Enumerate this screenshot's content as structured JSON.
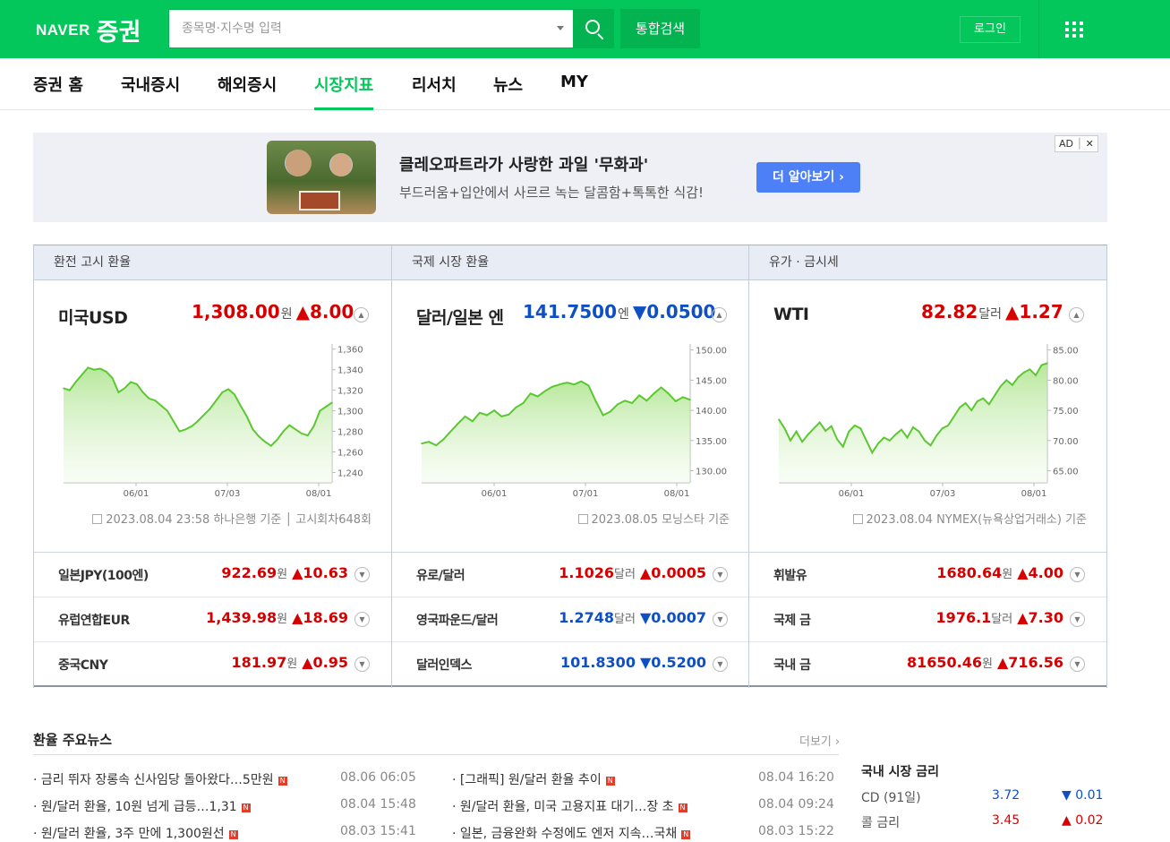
{
  "header": {
    "logo_brand": "NAVER",
    "logo_section": "증권",
    "search_placeholder": "종목명·지수명 입력",
    "search_button_label": "통합검색",
    "login_label": "로그인"
  },
  "nav": {
    "items": [
      "증권 홈",
      "국내증시",
      "해외증시",
      "시장지표",
      "리서치",
      "뉴스",
      "MY"
    ],
    "active": "시장지표"
  },
  "ad": {
    "title": "클레오파트라가 사랑한 과일 '무화과'",
    "desc": "부드러움+입안에서 사르르 녹는 달콤함+톡톡한 식감!",
    "button": "더 알아보기 ›",
    "tag": "AD",
    "close": "✕"
  },
  "panels": [
    {
      "header": "환전 고시 환율",
      "name": "미국USD",
      "price": "1,308.00",
      "unit": "원",
      "change": "▲8.00",
      "dir": "up",
      "source": "2023.08.04 23:58 하나은행 기준 │ 고시회차648회",
      "rows": [
        {
          "name": "일본JPY(100엔)",
          "value": "922.69",
          "unit": "원",
          "change": "▲10.63",
          "dir": "up"
        },
        {
          "name": "유럽연합EUR",
          "value": "1,439.98",
          "unit": "원",
          "change": "▲18.69",
          "dir": "up"
        },
        {
          "name": "중국CNY",
          "value": "181.97",
          "unit": "원",
          "change": "▲0.95",
          "dir": "up"
        }
      ]
    },
    {
      "header": "국제 시장 환율",
      "name": "달러/일본 엔",
      "price": "141.7500",
      "unit": "엔",
      "change": "▼0.0500",
      "dir": "dn",
      "source": "2023.08.05 모닝스타 기준",
      "rows": [
        {
          "name": "유로/달러",
          "value": "1.1026",
          "unit": "달러",
          "change": "▲0.0005",
          "dir": "up"
        },
        {
          "name": "영국파운드/달러",
          "value": "1.2748",
          "unit": "달러",
          "change": "▼0.0007",
          "dir": "dn"
        },
        {
          "name": "달러인덱스",
          "value": "101.8300",
          "unit": "",
          "change": "▼0.5200",
          "dir": "dn"
        }
      ]
    },
    {
      "header": "유가 · 금시세",
      "name": "WTI",
      "price": "82.82",
      "unit": "달러",
      "change": "▲1.27",
      "dir": "up",
      "source": "2023.08.04 NYMEX(뉴욕상업거래소) 기준",
      "rows": [
        {
          "name": "휘발유",
          "value": "1680.64",
          "unit": "원",
          "change": "▲4.00",
          "dir": "up"
        },
        {
          "name": "국제 금",
          "value": "1976.1",
          "unit": "달러",
          "change": "▲7.30",
          "dir": "up"
        },
        {
          "name": "국내 금",
          "value": "81650.46",
          "unit": "원",
          "change": "▲716.56",
          "dir": "up"
        }
      ]
    }
  ],
  "chart_data": [
    {
      "type": "area",
      "title": "미국USD",
      "x_ticks": [
        "06/01",
        "07/03",
        "08/01"
      ],
      "y_ticks": [
        1240,
        1260,
        1280,
        1300,
        1320,
        1340,
        1360
      ],
      "ylim": [
        1230,
        1365
      ],
      "values": [
        1322,
        1320,
        1328,
        1335,
        1342,
        1340,
        1341,
        1338,
        1332,
        1318,
        1322,
        1328,
        1326,
        1318,
        1312,
        1310,
        1305,
        1300,
        1290,
        1280,
        1282,
        1285,
        1290,
        1296,
        1302,
        1310,
        1318,
        1321,
        1316,
        1305,
        1295,
        1282,
        1275,
        1270,
        1266,
        1272,
        1280,
        1286,
        1282,
        1278,
        1276,
        1285,
        1300,
        1304,
        1308
      ]
    },
    {
      "type": "area",
      "title": "달러/일본 엔",
      "x_ticks": [
        "06/01",
        "07/01",
        "08/01"
      ],
      "y_ticks": [
        130,
        135,
        140,
        145,
        150
      ],
      "ylim": [
        128,
        151
      ],
      "values": [
        134.5,
        134.8,
        134.2,
        135.2,
        136.5,
        137.8,
        139.0,
        138.2,
        139.6,
        139.2,
        140.0,
        139.0,
        139.3,
        140.5,
        141.2,
        142.8,
        142.3,
        143.2,
        143.9,
        144.3,
        144.6,
        144.3,
        144.8,
        144.1,
        141.5,
        139.2,
        139.8,
        141.0,
        141.6,
        141.2,
        142.5,
        141.6,
        142.8,
        143.8,
        142.8,
        141.5,
        142.2,
        141.75
      ]
    },
    {
      "type": "area",
      "title": "WTI",
      "x_ticks": [
        "06/01",
        "07/03",
        "08/01"
      ],
      "y_ticks": [
        65,
        70,
        75,
        80,
        85
      ],
      "ylim": [
        63,
        86
      ],
      "values": [
        73.5,
        72.0,
        70.0,
        71.5,
        69.8,
        71.0,
        72.0,
        73.0,
        71.6,
        72.4,
        70.2,
        69.0,
        71.5,
        72.5,
        72.0,
        70.0,
        68.0,
        69.5,
        70.5,
        70.0,
        71.0,
        71.8,
        70.5,
        72.2,
        71.5,
        70.0,
        69.2,
        70.8,
        72.0,
        72.5,
        74.0,
        75.5,
        76.2,
        75.0,
        76.5,
        77.0,
        76.0,
        77.5,
        79.0,
        80.0,
        79.2,
        80.5,
        81.3,
        81.8,
        80.8,
        82.5,
        82.82
      ]
    }
  ],
  "news": {
    "title": "환율 주요뉴스",
    "more": "더보기 ›",
    "items": [
      {
        "text": "금리 뛰자 장롱속 신사임당 돌아왔다…5만원",
        "date": "08.06 06:05"
      },
      {
        "text": "원/달러 환율, 10원 넘게 급등…1,31",
        "date": "08.04 15:48"
      },
      {
        "text": "원/달러 환율, 3주 만에 1,300원선",
        "date": "08.03 15:41"
      },
      {
        "text": "[그래픽] 원/달러 환율 추이",
        "date": "08.04 16:20"
      },
      {
        "text": "원/달러 환율, 미국 고용지표 대기…장 초",
        "date": "08.04 09:24"
      },
      {
        "text": "일본, 금융완화 수정에도 엔저 지속…국채",
        "date": "08.03 15:22"
      }
    ],
    "badge": "N"
  },
  "rates": {
    "title": "국내 시장 금리",
    "items": [
      {
        "name": "CD (91일)",
        "value": "3.72",
        "change": "▼ 0.01",
        "dir": "dn"
      },
      {
        "name": "콜 금리",
        "value": "3.45",
        "change": "▲ 0.02",
        "dir": "up"
      }
    ]
  }
}
